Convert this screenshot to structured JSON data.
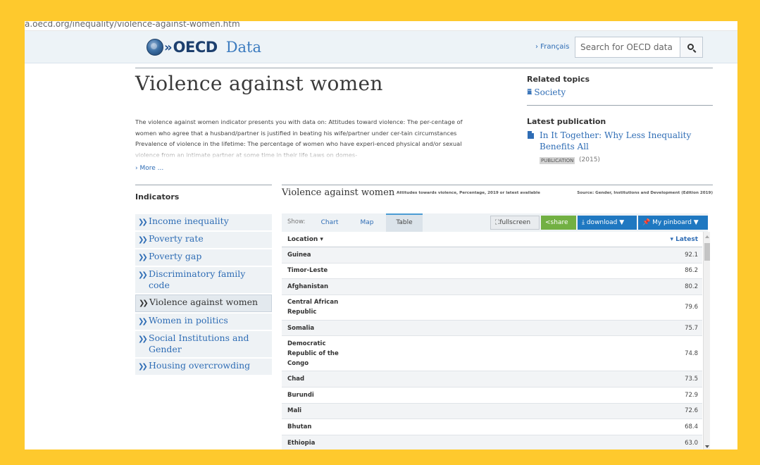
{
  "browser": {
    "url": "a.oecd.org/inequality/violence-against-women.htm"
  },
  "header": {
    "brand": "OECD",
    "section": "Data",
    "language_link": "› Français",
    "search_placeholder": "Search for OECD data"
  },
  "page": {
    "title": "Violence against women",
    "description": "The violence against women indicator presents you with data on: Attitudes toward violence: The per-centage of women who agree that a husband/partner is justified in beating his wife/partner under cer-tain circumstances Prevalence of violence in the lifetime: The percentage of women who have experi-enced physical and/or sexual violence from an intimate partner at some time in their life Laws on domes-",
    "more_link": "› More ..."
  },
  "related": {
    "heading": "Related topics",
    "topic": "Society"
  },
  "latest_publication": {
    "heading": "Latest publication",
    "title": "In It Together: Why Less Inequality Benefits All",
    "badge": "PUBLICATION",
    "year": "(2015)"
  },
  "indicators": {
    "heading": "Indicators",
    "items": [
      {
        "label": "Income inequality"
      },
      {
        "label": "Poverty rate"
      },
      {
        "label": "Poverty gap"
      },
      {
        "label": "Discriminatory family code"
      },
      {
        "label": "Violence against women"
      },
      {
        "label": "Women in politics"
      },
      {
        "label": "Social Institutions and Gender"
      },
      {
        "label": "Housing overcrowding"
      }
    ]
  },
  "chart": {
    "title": "Violence against women",
    "subtitle": "Attitudes towards violence, Percentage, 2019 or latest available",
    "source": "Source: Gender, Institutions and Development (Edition 2019)"
  },
  "toolbar": {
    "show_label": "Show:",
    "tabs": [
      "Chart",
      "Map",
      "Table"
    ],
    "fullscreen": "fullscreen",
    "share": "share",
    "download": "download ▼",
    "pinboard": "My pinboard ▼"
  },
  "table": {
    "col_location": "Location ▾",
    "col_latest": "▾ Latest",
    "rows": [
      {
        "location": "Guinea",
        "value": "92.1"
      },
      {
        "location": "Timor-Leste",
        "value": "86.2"
      },
      {
        "location": "Afghanistan",
        "value": "80.2"
      },
      {
        "location": "Central African Republic",
        "value": "79.6"
      },
      {
        "location": "Somalia",
        "value": "75.7"
      },
      {
        "location": "Democratic Republic of the Congo",
        "value": "74.8"
      },
      {
        "location": "Chad",
        "value": "73.5"
      },
      {
        "location": "Burundi",
        "value": "72.9"
      },
      {
        "location": "Mali",
        "value": "72.6"
      },
      {
        "location": "Bhutan",
        "value": "68.4"
      },
      {
        "location": "Ethiopia",
        "value": "63.0"
      }
    ]
  },
  "colors": {
    "frame_border": "#fec92d",
    "link_blue": "#2f6db5",
    "header_bg": "#edf3f7",
    "share_green": "#72b043",
    "button_blue": "#1f78c1"
  }
}
